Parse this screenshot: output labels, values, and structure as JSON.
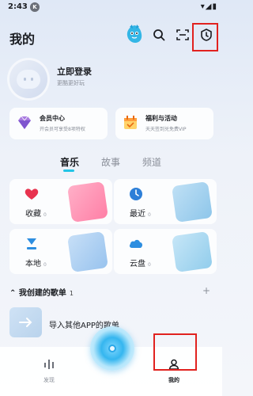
{
  "status_bar": {
    "time": "2:43",
    "badge": "K",
    "right": "▾◢▮"
  },
  "header": {
    "title": "我的"
  },
  "profile": {
    "login": "立即登录",
    "subtitle": "更酷更好玩"
  },
  "promos": [
    {
      "title": "会员中心",
      "subtitle": "开会员可享受8项特权"
    },
    {
      "title": "福利与活动",
      "subtitle": "天天签到兑免费VIP"
    }
  ],
  "tabs": [
    {
      "label": "音乐",
      "active": true
    },
    {
      "label": "故事",
      "active": false
    },
    {
      "label": "频道",
      "active": false
    }
  ],
  "tiles": [
    {
      "label": "收藏",
      "count": "0",
      "icon": "heart-icon"
    },
    {
      "label": "最近",
      "count": "0",
      "icon": "clock-icon"
    },
    {
      "label": "本地",
      "count": "0",
      "icon": "download-icon"
    },
    {
      "label": "云盘",
      "count": "0",
      "icon": "cloud-icon"
    }
  ],
  "playlists": {
    "title": "我创建的歌单",
    "count": "1",
    "import_label": "导入其他APP的歌单"
  },
  "bottom_nav": [
    {
      "label": "发现",
      "icon": "discover-icon"
    },
    {
      "label": "我的",
      "icon": "user-icon"
    }
  ],
  "colors": {
    "accent": "#22c4e6",
    "highlight": "#e1221f"
  }
}
